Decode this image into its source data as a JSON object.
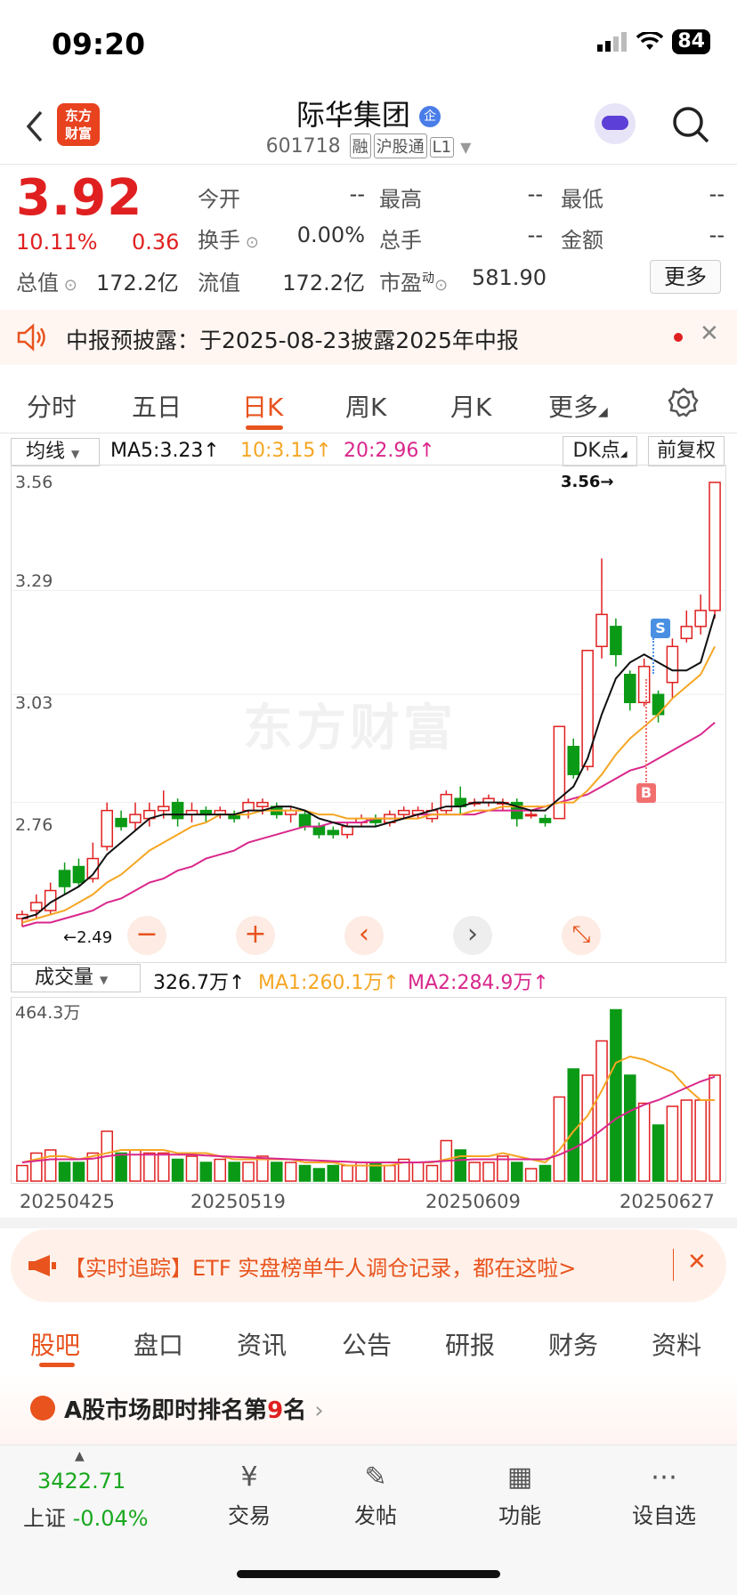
{
  "status_bar": {
    "time": "09:20",
    "battery": "84"
  },
  "header": {
    "title": "际华集团",
    "code": "601718",
    "tags": [
      "融",
      "沪股通",
      "L1"
    ],
    "badge": "企",
    "logo_text": "东方\n财富"
  },
  "quote": {
    "price": "3.92",
    "change_pct": "10.11%",
    "change": "0.36",
    "open_label": "今开",
    "open": "--",
    "high_label": "最高",
    "high": "--",
    "low_label": "最低",
    "low": "--",
    "turnover_label": "换手",
    "turnover": "0.00%",
    "volume_label": "总手",
    "volume": "--",
    "amount_label": "金额",
    "amount": "--",
    "mcap_label": "总值",
    "mcap": "172.2亿",
    "float_label": "流值",
    "float": "172.2亿",
    "pe_label": "市盈",
    "pe_sup": "动",
    "pe": "581.90",
    "more": "更多"
  },
  "notice": {
    "text": "中报预披露：于2025-08-23披露2025年中报"
  },
  "period_tabs": [
    "分时",
    "五日",
    "日K",
    "周K",
    "月K",
    "更多"
  ],
  "active_tab": "日K",
  "indicator": {
    "selector": "均线",
    "ma5": "MA5:3.23↑",
    "ma10": "10:3.15↑",
    "ma20": "20:2.96↑",
    "dk": "DK点",
    "adjust": "前复权"
  },
  "price_axis": [
    "3.56",
    "3.29",
    "3.03",
    "2.76",
    "2.49"
  ],
  "high_mark": "3.56→",
  "low_mark": "2.49",
  "watermark": "东方财富",
  "signals": {
    "sell": "S",
    "buy": "B"
  },
  "chart_controls": [
    "−",
    "+",
    "‹",
    "›",
    "⤡"
  ],
  "volume": {
    "selector": "成交量",
    "value": "326.7万↑",
    "ma1": "MA1:260.1万↑",
    "ma2": "MA2:284.9万↑",
    "axis_max": "464.3万"
  },
  "dates": [
    "20250425",
    "20250519",
    "20250609",
    "20250627"
  ],
  "chart_data": {
    "type": "candlestick",
    "ylim": [
      2.45,
      3.58
    ],
    "candles": [
      [
        2.47,
        2.48,
        2.45,
        2.49
      ],
      [
        2.49,
        2.51,
        2.47,
        2.53
      ],
      [
        2.49,
        2.54,
        2.48,
        2.56
      ],
      [
        2.59,
        2.55,
        2.53,
        2.61
      ],
      [
        2.6,
        2.56,
        2.55,
        2.62
      ],
      [
        2.57,
        2.62,
        2.56,
        2.66
      ],
      [
        2.65,
        2.74,
        2.64,
        2.76
      ],
      [
        2.72,
        2.7,
        2.69,
        2.74
      ],
      [
        2.71,
        2.73,
        2.69,
        2.76
      ],
      [
        2.72,
        2.74,
        2.7,
        2.76
      ],
      [
        2.74,
        2.75,
        2.72,
        2.79
      ],
      [
        2.76,
        2.72,
        2.7,
        2.77
      ],
      [
        2.73,
        2.74,
        2.71,
        2.76
      ],
      [
        2.74,
        2.73,
        2.71,
        2.75
      ],
      [
        2.73,
        2.74,
        2.72,
        2.75
      ],
      [
        2.73,
        2.72,
        2.71,
        2.74
      ],
      [
        2.74,
        2.76,
        2.72,
        2.77
      ],
      [
        2.75,
        2.76,
        2.73,
        2.77
      ],
      [
        2.75,
        2.73,
        2.72,
        2.76
      ],
      [
        2.73,
        2.74,
        2.71,
        2.75
      ],
      [
        2.73,
        2.7,
        2.69,
        2.74
      ],
      [
        2.7,
        2.68,
        2.67,
        2.71
      ],
      [
        2.69,
        2.68,
        2.67,
        2.7
      ],
      [
        2.68,
        2.7,
        2.67,
        2.71
      ],
      [
        2.71,
        2.72,
        2.7,
        2.73
      ],
      [
        2.72,
        2.71,
        2.7,
        2.73
      ],
      [
        2.71,
        2.73,
        2.7,
        2.74
      ],
      [
        2.73,
        2.74,
        2.72,
        2.75
      ],
      [
        2.73,
        2.74,
        2.72,
        2.75
      ],
      [
        2.72,
        2.74,
        2.71,
        2.76
      ],
      [
        2.74,
        2.78,
        2.73,
        2.79
      ],
      [
        2.77,
        2.75,
        2.73,
        2.8
      ],
      [
        2.76,
        2.76,
        2.75,
        2.77
      ],
      [
        2.76,
        2.77,
        2.75,
        2.78
      ],
      [
        2.76,
        2.76,
        2.74,
        2.77
      ],
      [
        2.76,
        2.72,
        2.7,
        2.77
      ],
      [
        2.73,
        2.73,
        2.72,
        2.74
      ],
      [
        2.72,
        2.71,
        2.7,
        2.73
      ],
      [
        2.72,
        2.95,
        2.72,
        2.95
      ],
      [
        2.9,
        2.83,
        2.82,
        2.92
      ],
      [
        2.85,
        3.14,
        2.84,
        3.14
      ],
      [
        3.15,
        3.23,
        3.12,
        3.37
      ],
      [
        3.2,
        3.13,
        3.1,
        3.22
      ],
      [
        3.08,
        3.01,
        2.99,
        3.09
      ],
      [
        3.01,
        3.1,
        3.0,
        3.12
      ],
      [
        3.03,
        2.98,
        2.96,
        3.04
      ],
      [
        3.06,
        3.15,
        3.02,
        3.17
      ],
      [
        3.17,
        3.2,
        3.16,
        3.24
      ],
      [
        3.2,
        3.24,
        3.18,
        3.28
      ],
      [
        3.24,
        3.56,
        3.22,
        3.56
      ]
    ],
    "ma5": [
      2.47,
      2.48,
      2.51,
      2.53,
      2.55,
      2.58,
      2.63,
      2.66,
      2.69,
      2.72,
      2.73,
      2.73,
      2.73,
      2.73,
      2.73,
      2.73,
      2.74,
      2.74,
      2.75,
      2.75,
      2.74,
      2.72,
      2.71,
      2.7,
      2.7,
      2.7,
      2.71,
      2.72,
      2.73,
      2.74,
      2.75,
      2.75,
      2.76,
      2.76,
      2.76,
      2.75,
      2.74,
      2.74,
      2.77,
      2.8,
      2.87,
      2.98,
      3.07,
      3.11,
      3.13,
      3.11,
      3.09,
      3.09,
      3.11,
      3.23
    ],
    "ma10": [
      2.46,
      2.47,
      2.48,
      2.49,
      2.51,
      2.53,
      2.56,
      2.58,
      2.61,
      2.64,
      2.66,
      2.68,
      2.7,
      2.71,
      2.73,
      2.73,
      2.73,
      2.74,
      2.74,
      2.74,
      2.74,
      2.73,
      2.73,
      2.72,
      2.72,
      2.72,
      2.72,
      2.72,
      2.72,
      2.73,
      2.73,
      2.73,
      2.74,
      2.74,
      2.75,
      2.75,
      2.75,
      2.75,
      2.76,
      2.76,
      2.79,
      2.83,
      2.88,
      2.92,
      2.95,
      2.98,
      3.02,
      3.05,
      3.08,
      3.15
    ],
    "ma20": [
      2.45,
      2.46,
      2.46,
      2.47,
      2.48,
      2.49,
      2.51,
      2.52,
      2.54,
      2.56,
      2.57,
      2.59,
      2.6,
      2.62,
      2.63,
      2.64,
      2.66,
      2.67,
      2.68,
      2.69,
      2.7,
      2.7,
      2.71,
      2.71,
      2.71,
      2.72,
      2.72,
      2.72,
      2.73,
      2.73,
      2.73,
      2.73,
      2.73,
      2.74,
      2.74,
      2.74,
      2.74,
      2.75,
      2.76,
      2.77,
      2.78,
      2.8,
      2.82,
      2.84,
      2.85,
      2.87,
      2.89,
      2.91,
      2.93,
      2.96
    ],
    "volumes": [
      0.5,
      0.9,
      1.0,
      0.6,
      0.6,
      0.9,
      1.6,
      0.9,
      1.0,
      0.9,
      0.9,
      0.7,
      0.8,
      0.6,
      0.7,
      0.6,
      0.6,
      0.8,
      0.6,
      0.6,
      0.5,
      0.4,
      0.5,
      0.5,
      0.6,
      0.6,
      0.5,
      0.7,
      0.6,
      0.5,
      1.3,
      1.0,
      0.6,
      0.6,
      0.8,
      0.6,
      0.4,
      0.5,
      2.7,
      3.6,
      3.4,
      4.5,
      5.5,
      3.4,
      2.5,
      1.8,
      2.4,
      2.6,
      2.6,
      3.4
    ],
    "vol_ma1": [
      0.6,
      0.7,
      0.8,
      0.8,
      0.7,
      0.8,
      0.9,
      1.0,
      1.0,
      1.0,
      1.0,
      0.9,
      0.9,
      0.9,
      0.8,
      0.7,
      0.7,
      0.7,
      0.7,
      0.7,
      0.6,
      0.6,
      0.6,
      0.5,
      0.5,
      0.5,
      0.5,
      0.6,
      0.6,
      0.6,
      0.7,
      0.8,
      0.8,
      0.8,
      0.9,
      0.8,
      0.7,
      0.6,
      1.0,
      1.6,
      2.1,
      2.9,
      3.8,
      4.0,
      3.9,
      3.7,
      3.5,
      3.0,
      2.6,
      2.6
    ],
    "vol_ma2": [
      0.6,
      0.65,
      0.7,
      0.7,
      0.7,
      0.72,
      0.8,
      0.85,
      0.85,
      0.85,
      0.85,
      0.85,
      0.85,
      0.82,
      0.8,
      0.78,
      0.76,
      0.74,
      0.72,
      0.7,
      0.68,
      0.66,
      0.64,
      0.62,
      0.6,
      0.6,
      0.6,
      0.6,
      0.6,
      0.62,
      0.65,
      0.68,
      0.7,
      0.7,
      0.7,
      0.7,
      0.7,
      0.7,
      0.85,
      1.05,
      1.3,
      1.65,
      2.0,
      2.25,
      2.45,
      2.6,
      2.8,
      3.0,
      3.2,
      3.35
    ],
    "vol_ylim": [
      0,
      5.6
    ]
  },
  "banner": {
    "text": "【实时追踪】ETF 实盘榜单牛人调仓记录，都在这啦>"
  },
  "bottom_tabs": [
    "股吧",
    "盘口",
    "资讯",
    "公告",
    "研报",
    "财务",
    "资料"
  ],
  "rank": {
    "prefix": "A股市场即时排名第",
    "num": "9",
    "suffix": "名"
  },
  "index": {
    "value": "3422.71",
    "name": "上证",
    "change": "-0.04%"
  },
  "nav": [
    "交易",
    "发帖",
    "功能",
    "设自选"
  ]
}
